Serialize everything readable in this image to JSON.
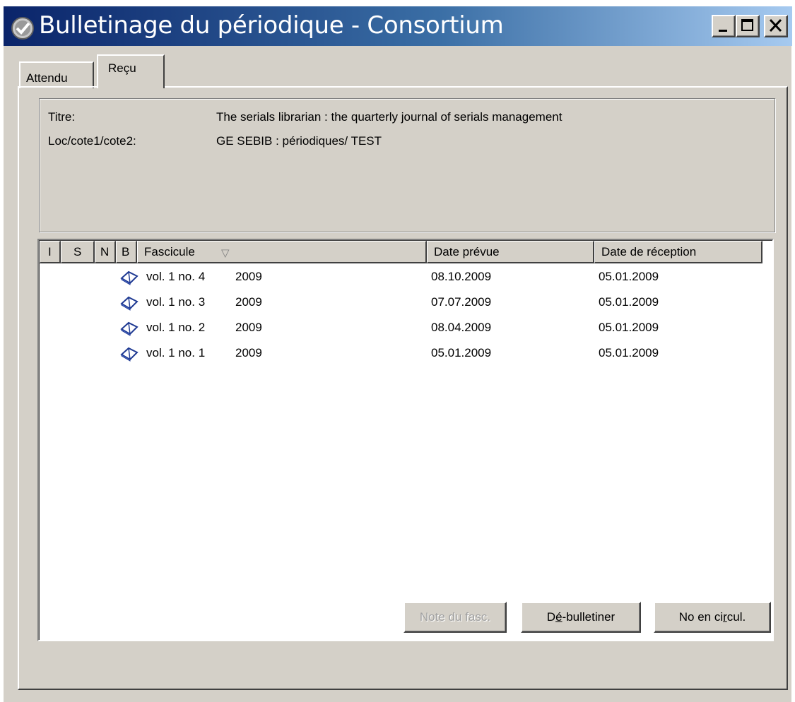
{
  "window": {
    "title": "Bulletinage du périodique - Consortium",
    "icon": "app-checkmark-icon"
  },
  "tabs": [
    {
      "label": "Attendu",
      "active": false
    },
    {
      "label": "Reçu",
      "active": true
    }
  ],
  "info": {
    "title_label": "Titre:",
    "title_value": "The serials librarian : the quarterly journal of serials management",
    "location_label": "Loc/cote1/cote2:",
    "location_value": "GE SEBIB : périodiques/ TEST"
  },
  "table": {
    "columns": [
      "I",
      "S",
      "N",
      "B",
      "Fascicule",
      "Date prévue",
      "Date de réception"
    ],
    "sort_indicator": "▽",
    "rows": [
      {
        "issue": "vol. 1 no. 4",
        "year": "2009",
        "expected": "08.10.2009",
        "received": "05.01.2009",
        "icon": "book-icon"
      },
      {
        "issue": "vol. 1 no. 3",
        "year": "2009",
        "expected": "07.07.2009",
        "received": "05.01.2009",
        "icon": "book-icon"
      },
      {
        "issue": "vol. 1 no. 2",
        "year": "2009",
        "expected": "08.04.2009",
        "received": "05.01.2009",
        "icon": "book-icon"
      },
      {
        "issue": "vol. 1 no. 1",
        "year": "2009",
        "expected": "05.01.2009",
        "received": "05.01.2009",
        "icon": "book-icon"
      }
    ]
  },
  "buttons": {
    "note": "Note du fasc.",
    "unbulletin_prefix": "D",
    "unbulletin_mnemonic": "é",
    "unbulletin_suffix": "-bulletiner",
    "circul_prefix": "No en ci",
    "circul_mnemonic": "r",
    "circul_suffix": "cul."
  }
}
